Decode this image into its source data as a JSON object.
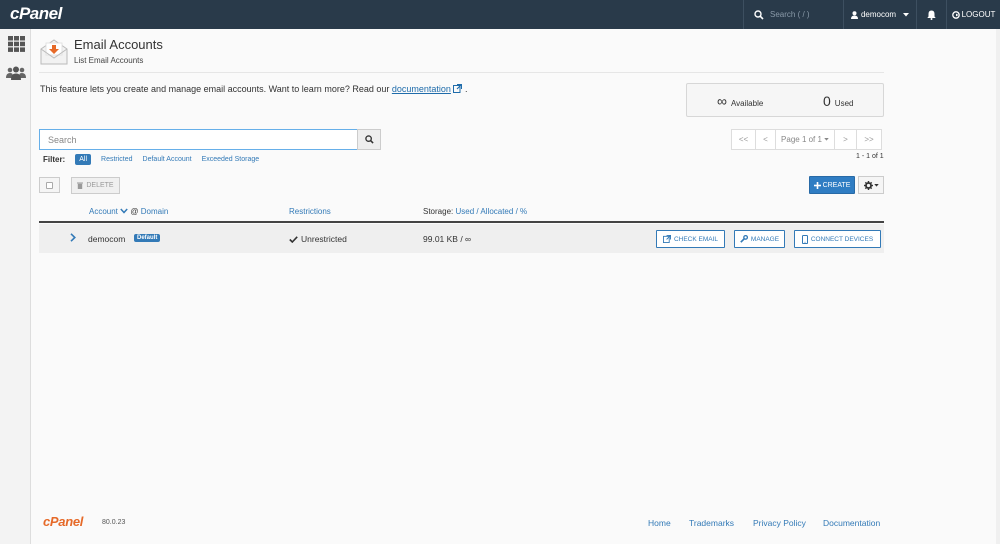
{
  "topbar": {
    "brand": "cPanel",
    "search_placeholder": "Search ( / )",
    "username": "democom",
    "logout": "LOGOUT"
  },
  "rail": {
    "items": [
      "grid-icon",
      "users-icon"
    ]
  },
  "header": {
    "title": "Email Accounts",
    "breadcrumb": "List Email Accounts"
  },
  "intro": {
    "text": "This feature lets you create and manage email accounts. Want to learn more? Read our ",
    "link": "documentation",
    "suffix": "."
  },
  "stats": {
    "available_value": "∞",
    "available_label": "Available",
    "used_value": "0",
    "used_label": "Used"
  },
  "search": {
    "placeholder": "Search"
  },
  "pagination": {
    "first": "<<",
    "prev": "<",
    "page_label": "Page 1 of 1",
    "next": ">",
    "last": ">>",
    "count": "1 - 1 of 1"
  },
  "filter": {
    "label": "Filter:",
    "options": [
      "All",
      "Restricted",
      "Default Account",
      "Exceeded Storage"
    ],
    "active": "All"
  },
  "actions": {
    "delete": "DELETE",
    "create": "CREATE"
  },
  "table": {
    "headers": {
      "account": "Account",
      "at": "@",
      "domain": "Domain",
      "restrictions": "Restrictions",
      "storage_prefix": "Storage:",
      "used": "Used",
      "sep1": "/",
      "allocated": "Allocated",
      "sep2": "/",
      "percent": "%"
    },
    "rows": [
      {
        "account": "democom",
        "badge": "Default",
        "restriction": "Unrestricted",
        "storage": "99.01 KB / ∞",
        "check_email": "CHECK EMAIL",
        "manage": "MANAGE",
        "connect": "CONNECT DEVICES"
      }
    ]
  },
  "footer": {
    "brand": "cPanel",
    "version": "80.0.23",
    "links": [
      "Home",
      "Trademarks",
      "Privacy Policy",
      "Documentation"
    ]
  },
  "colors": {
    "topbar": "#293a4a",
    "accent": "#337ab7",
    "brand_orange": "#e66a29"
  }
}
